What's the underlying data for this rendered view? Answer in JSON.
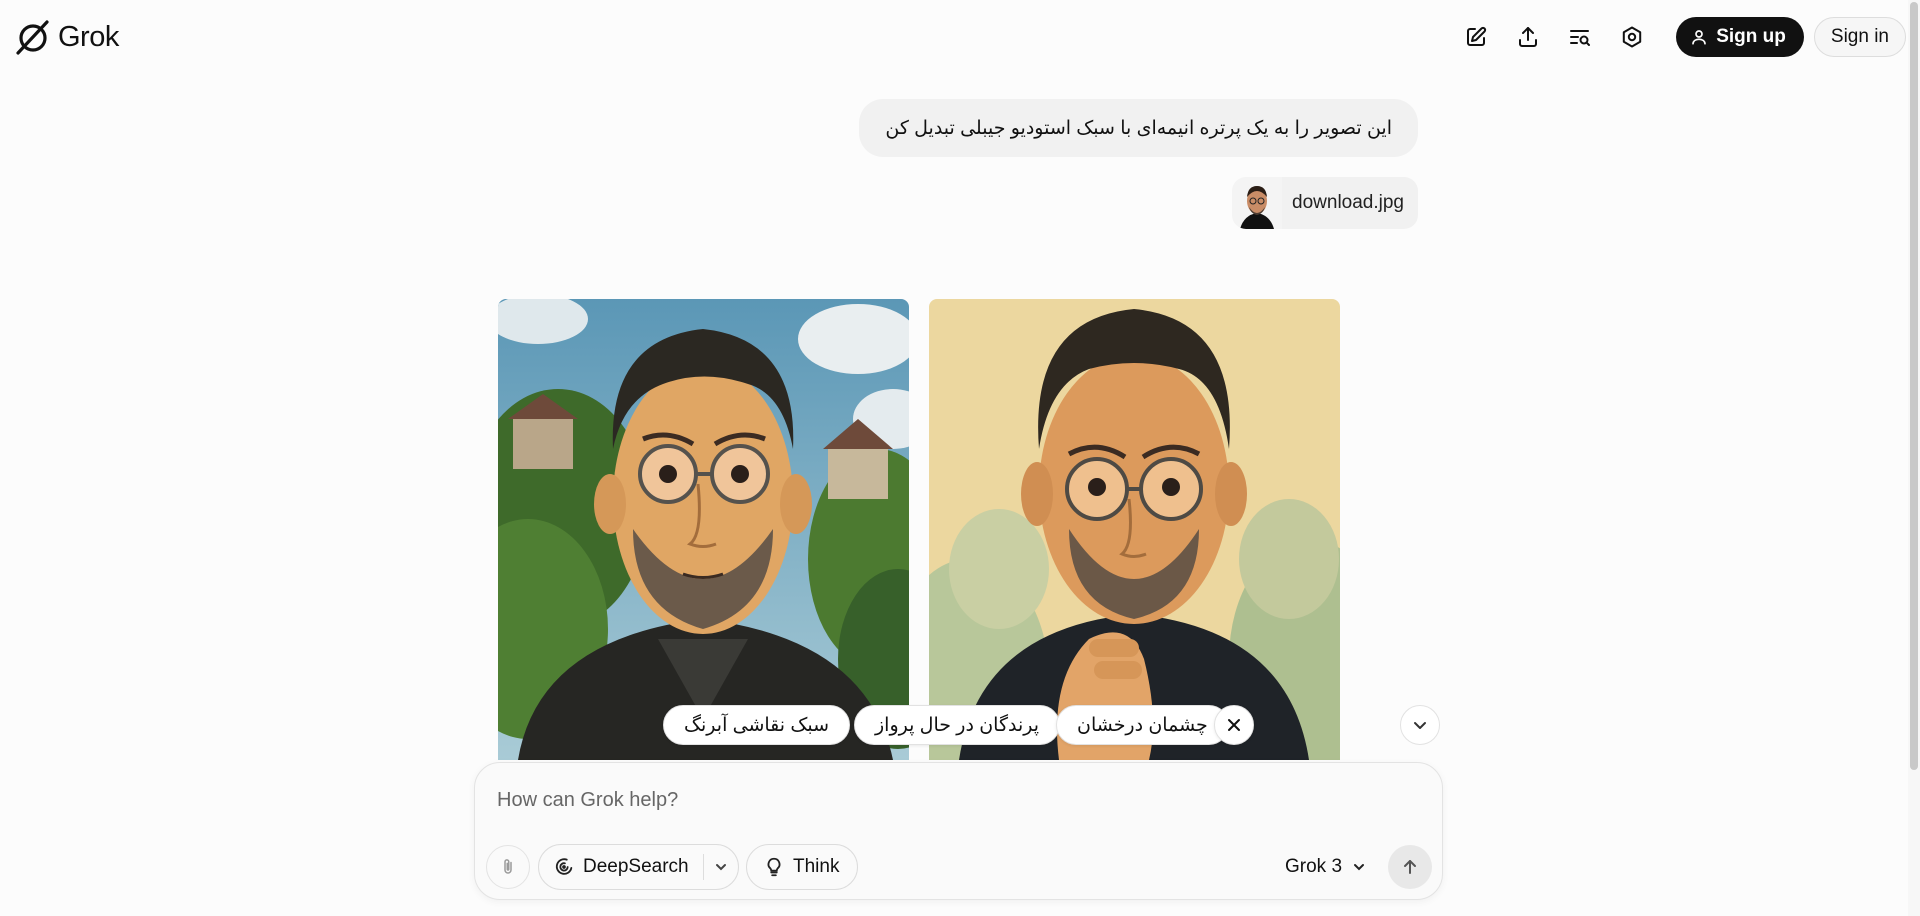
{
  "app": {
    "name": "Grok"
  },
  "header": {
    "icons": [
      "new-chat-icon",
      "share-icon",
      "search-history-icon",
      "settings-icon"
    ],
    "signup_label": "Sign up",
    "signin_label": "Sign in"
  },
  "conversation": {
    "user_message": "این تصویر را به یک پرتره انیمه‌ای با سبک استودیو جیبلی تبدیل کن",
    "attachment_name": "download.jpg",
    "generated_images": [
      "ghibli-portrait-1",
      "ghibli-portrait-2"
    ]
  },
  "suggestions": [
    "چشمان درخشان",
    "پرندگان در حال پرواز",
    "سبک نقاشی آبرنگ"
  ],
  "composer": {
    "placeholder": "How can Grok help?",
    "deepsearch_label": "DeepSearch",
    "think_label": "Think",
    "model_label": "Grok 3"
  },
  "colors": {
    "primary_button": "#111111",
    "page_background": "#fcfcfc",
    "bubble_background": "#f1f1f1"
  }
}
